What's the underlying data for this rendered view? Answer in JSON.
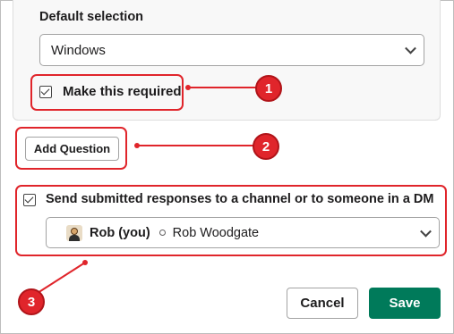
{
  "question": {
    "default_selection_label": "Default selection",
    "default_selection_value": "Windows",
    "required_label": "Make this required",
    "required_checked": true
  },
  "add_question_label": "Add Question",
  "send_responses": {
    "label": "Send submitted responses to a channel or to someone in a DM",
    "checked": true,
    "recipient_name": "Rob (you)",
    "recipient_secondary": "Rob Woodgate"
  },
  "footer": {
    "cancel_label": "Cancel",
    "save_label": "Save"
  },
  "callouts": [
    "1",
    "2",
    "3"
  ],
  "colors": {
    "annotation_red": "#e0252b",
    "save_green": "#007a5a"
  }
}
